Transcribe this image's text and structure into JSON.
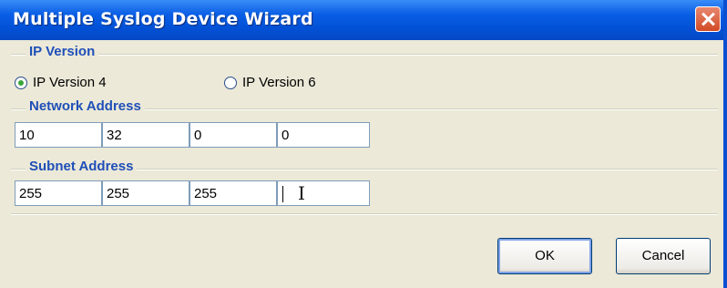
{
  "window": {
    "title": "Multiple Syslog Device Wizard"
  },
  "ip_version": {
    "label": "IP Version",
    "options": [
      {
        "label": "IP Version 4",
        "selected": true
      },
      {
        "label": "IP Version 6",
        "selected": false
      }
    ]
  },
  "network_address": {
    "label": "Network Address",
    "octets": [
      "10",
      "32",
      "0",
      "0"
    ]
  },
  "subnet_address": {
    "label": "Subnet Address",
    "octets": [
      "255",
      "255",
      "255",
      ""
    ]
  },
  "buttons": {
    "ok": "OK",
    "cancel": "Cancel"
  }
}
